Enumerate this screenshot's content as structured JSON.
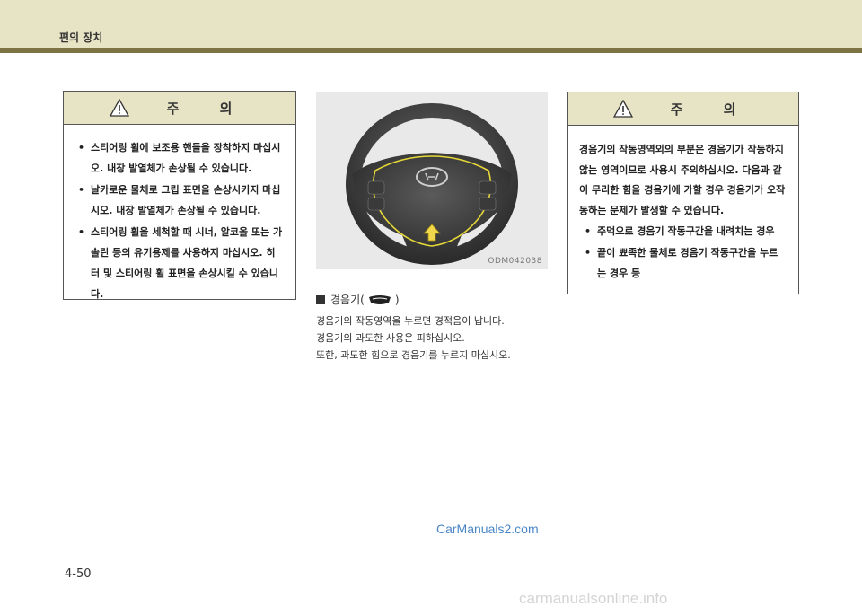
{
  "header": {
    "title": "편의 장치"
  },
  "caution_left": {
    "title": "주 의",
    "bullets": [
      "스티어링 휠에 보조용 핸들을 장착하지 마십시오. 내장 발열체가 손상될 수 있습니다.",
      "날카로운 물체로 그립 표면을 손상시키지 마십시오. 내장 발열체가 손상될 수 있습니다.",
      "스티어링 휠을 세척할 때 시너, 알코올 또는 가솔린 등의 유기용제를 사용하지 마십시오. 히터 및 스티어링 휠 표면을 손상시킬 수 있습니다."
    ]
  },
  "figure": {
    "code": "ODM042038"
  },
  "horn": {
    "heading_prefix": "경음기(",
    "heading_suffix": " )",
    "lines": [
      "경음기의 작동영역을 누르면 경적음이 납니다.",
      "경음기의 과도한 사용은 피하십시오.",
      "또한, 과도한 힘으로 경음기를 누르지 마십시오."
    ]
  },
  "caution_right": {
    "title": "주 의",
    "paragraph": "경음기의 작동영역외의 부분은 경음기가 작동하지 않는 영역이므로 사용시 주의하십시오. 다음과 같이 무리한 힘을 경음기에 가할 경우 경음기가 오작동하는 문제가 발생할 수 있습니다.",
    "bullets": [
      "주먹으로 경음기 작동구간을 내려치는 경우",
      "끝이 뾰족한 물체로 경음기 작동구간을 누르는 경우 등"
    ]
  },
  "watermark": "CarManuals2.com",
  "page_number": "4-50",
  "footer_watermark": "carmanualsonline.info"
}
